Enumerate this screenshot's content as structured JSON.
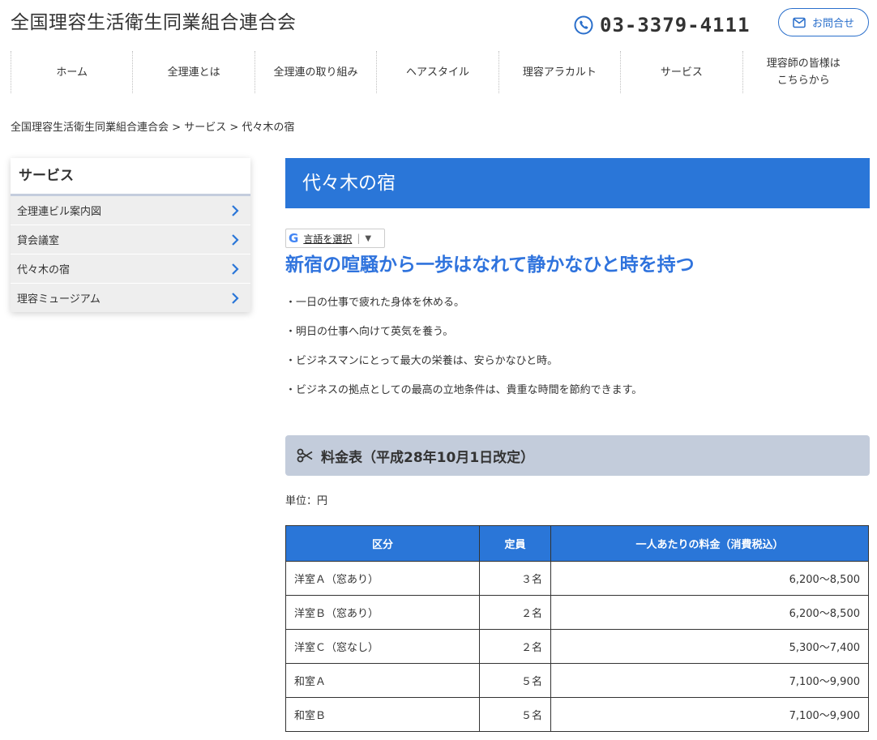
{
  "header": {
    "site_title": "全国理容生活衛生同業組合連合会",
    "phone": "03-3379-4111",
    "contact_label": "お問合せ",
    "accent_color": "#2a76d8"
  },
  "nav": {
    "items": [
      {
        "label": "ホーム"
      },
      {
        "label": "全理連とは"
      },
      {
        "label": "全理連の取り組み"
      },
      {
        "label": "ヘアスタイル"
      },
      {
        "label": "理容アラカルト"
      },
      {
        "label": "サービス"
      },
      {
        "label": "理容師の皆様は\nこちらから"
      }
    ]
  },
  "breadcrumb": {
    "items": [
      "全国理容生活衛生同業組合連合会",
      "サービス",
      "代々木の宿"
    ],
    "separator": " > "
  },
  "sidebar": {
    "title": "サービス",
    "items": [
      {
        "label": "全理連ビル案内図",
        "icon": "chevron-right-icon"
      },
      {
        "label": "貸会議室",
        "icon": "chevron-right-icon"
      },
      {
        "label": "代々木の宿",
        "icon": "chevron-right-icon"
      },
      {
        "label": "理容ミュージアム",
        "icon": "chevron-right-icon"
      }
    ]
  },
  "main": {
    "page_title": "代々木の宿",
    "translate": {
      "label": "言語を選択",
      "arrow": "▼",
      "logo": "G"
    },
    "headline": "新宿の喧騒から一歩はなれて静かなひと時を持つ",
    "bullets": [
      "・一日の仕事で疲れた身体を休める。",
      "・明日の仕事へ向けて英気を養う。",
      "・ビジネスマンにとって最大の栄養は、安らかなひと時。",
      "・ビジネスの拠点としての最高の立地条件は、貴重な時間を節約できます。"
    ],
    "section_title": "料金表（平成28年10月1日改定）",
    "unit": "単位：円",
    "table": {
      "headers": [
        "区分",
        "定員",
        "一人あたりの料金（消費税込）"
      ],
      "rows": [
        [
          "洋室Ａ（窓あり）",
          "３名",
          "6,200～8,500"
        ],
        [
          "洋室Ｂ（窓あり）",
          "２名",
          "6,200～8,500"
        ],
        [
          "洋室Ｃ（窓なし）",
          "２名",
          "5,300～7,400"
        ],
        [
          "和室Ａ",
          "５名",
          "7,100～9,900"
        ],
        [
          "和室Ｂ",
          "５名",
          "7,100～9,900"
        ]
      ]
    }
  }
}
